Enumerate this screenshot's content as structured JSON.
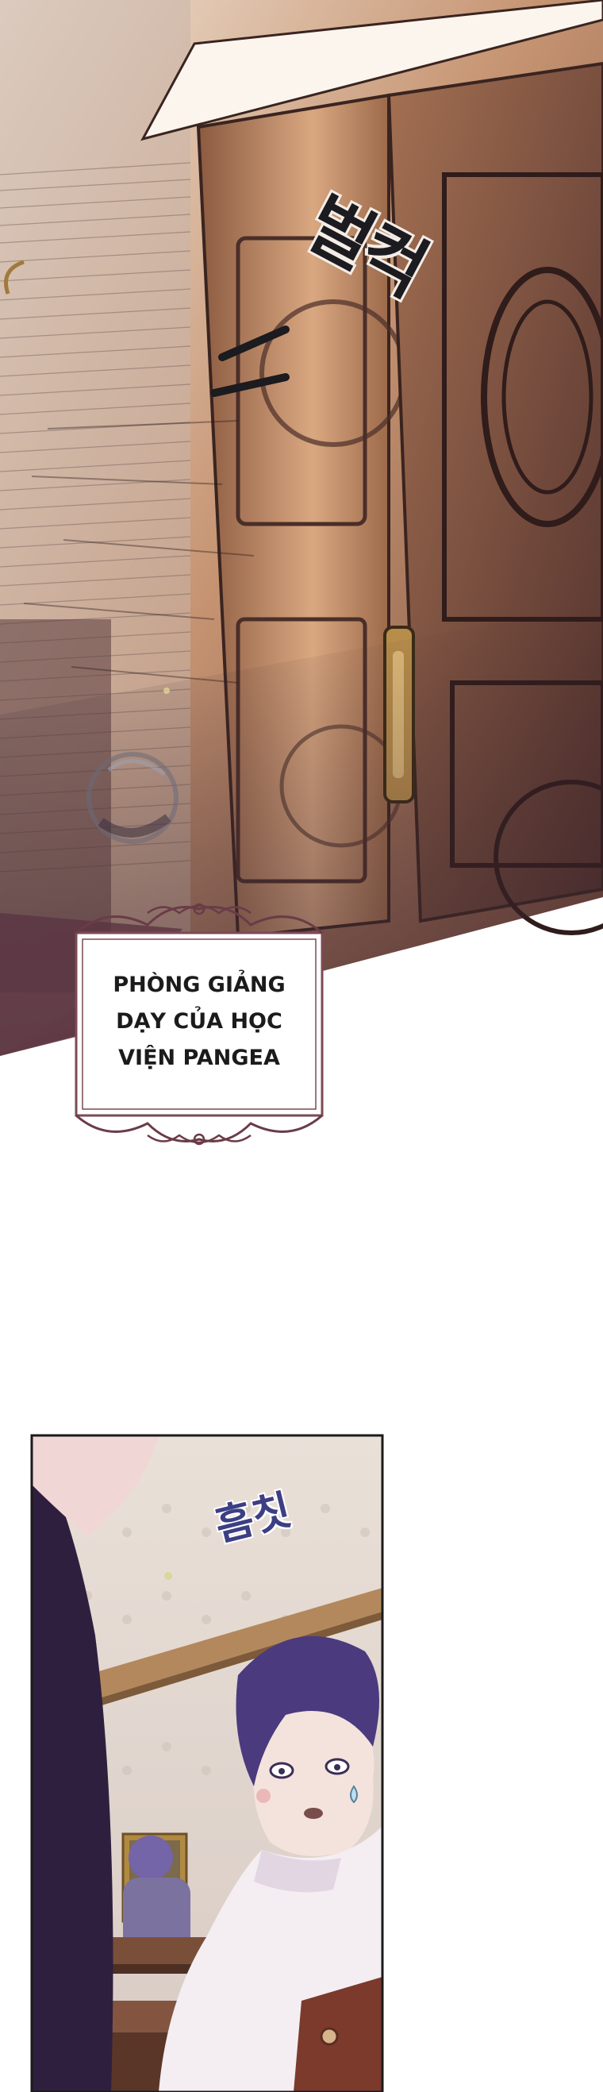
{
  "panel_top": {
    "sfx_door": "벌컥"
  },
  "caption": {
    "lines": [
      "PHÒNG GIẢNG",
      "DẠY CỦA HỌC",
      "VIỆN PANGEA"
    ]
  },
  "panel_bottom": {
    "sfx_flinch": "흠칫"
  },
  "colors": {
    "door_wood": "#7a4d36",
    "wall_light": "#efe6dc",
    "hair_purple": "#4b3a7e",
    "sfx_blue": "#3d3f84"
  }
}
